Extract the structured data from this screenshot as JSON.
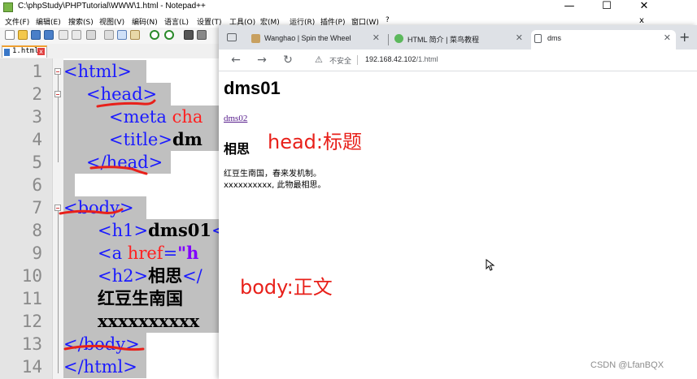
{
  "notepad": {
    "title": "C:\\phpStudy\\PHPTutorial\\WWW\\1.html - Notepad++",
    "window_controls": {
      "minimize": "—",
      "maximize": "☐",
      "close": "✕",
      "close_doc": "x"
    },
    "menu": [
      "文件(F)",
      "编辑(E)",
      "搜索(S)",
      "视图(V)",
      "编码(N)",
      "语言(L)",
      "设置(T)",
      "工具(O)",
      "宏(M)",
      "运行(R)",
      "插件(P)",
      "窗口(W)",
      "?"
    ],
    "tab": {
      "label": "1.html",
      "close": "x"
    },
    "lines": [
      "1",
      "2",
      "3",
      "4",
      "5",
      "6",
      "7",
      "8",
      "9",
      "10",
      "11",
      "12",
      "13",
      "14"
    ],
    "code": {
      "l1_tag": "<html>",
      "l2_tag": "<head>",
      "l3_tag": "<meta ",
      "l3_attr": "cha",
      "l4_tag": "<title>",
      "l4_txt": "dm",
      "l5_tag": "</head>",
      "l7_tag": "<body>",
      "l8_tag": "<h1>",
      "l8_txt": "dms01",
      "l8_tag2": "<",
      "l9_tag": "<a ",
      "l9_attr": "href",
      "l9_eq": "=",
      "l9_str": "\"h",
      "l10_tag": "<h2>",
      "l10_txt": "相思",
      "l10_tag2": "</",
      "l11_txt": "红豆生南国",
      "l12_txt": "xxxxxxxxxx",
      "l13_tag": "</body>",
      "l14_tag": "</html>"
    }
  },
  "browser": {
    "tabs": [
      {
        "label": "Wanghao | Spin the Wheel",
        "icon": "wheel-icon",
        "color": "#c8a060"
      },
      {
        "label": "HTML 简介 | 菜鸟教程",
        "icon": "runoob-icon",
        "color": "#5cb85c"
      },
      {
        "label": "dms",
        "icon": "page-icon",
        "color": "#ffffff"
      }
    ],
    "tab_close": "✕",
    "new_tab": "+",
    "nav": {
      "back": "←",
      "forward": "→",
      "reload": "↻"
    },
    "security_label": "不安全",
    "warning_icon": "⚠",
    "url_host": "192.168.42.102",
    "url_path": "/1.html"
  },
  "page": {
    "h1": "dms01",
    "link": "dms02",
    "h2": "相思",
    "paragraph": "红豆生南国，春来发机制。\nxxxxxxxxxx, 此物最相思。"
  },
  "annotations": {
    "head_note": "head:标题",
    "body_note": "body:正文",
    "color": "#e8201a"
  },
  "watermark": "CSDN @LfanBQX"
}
